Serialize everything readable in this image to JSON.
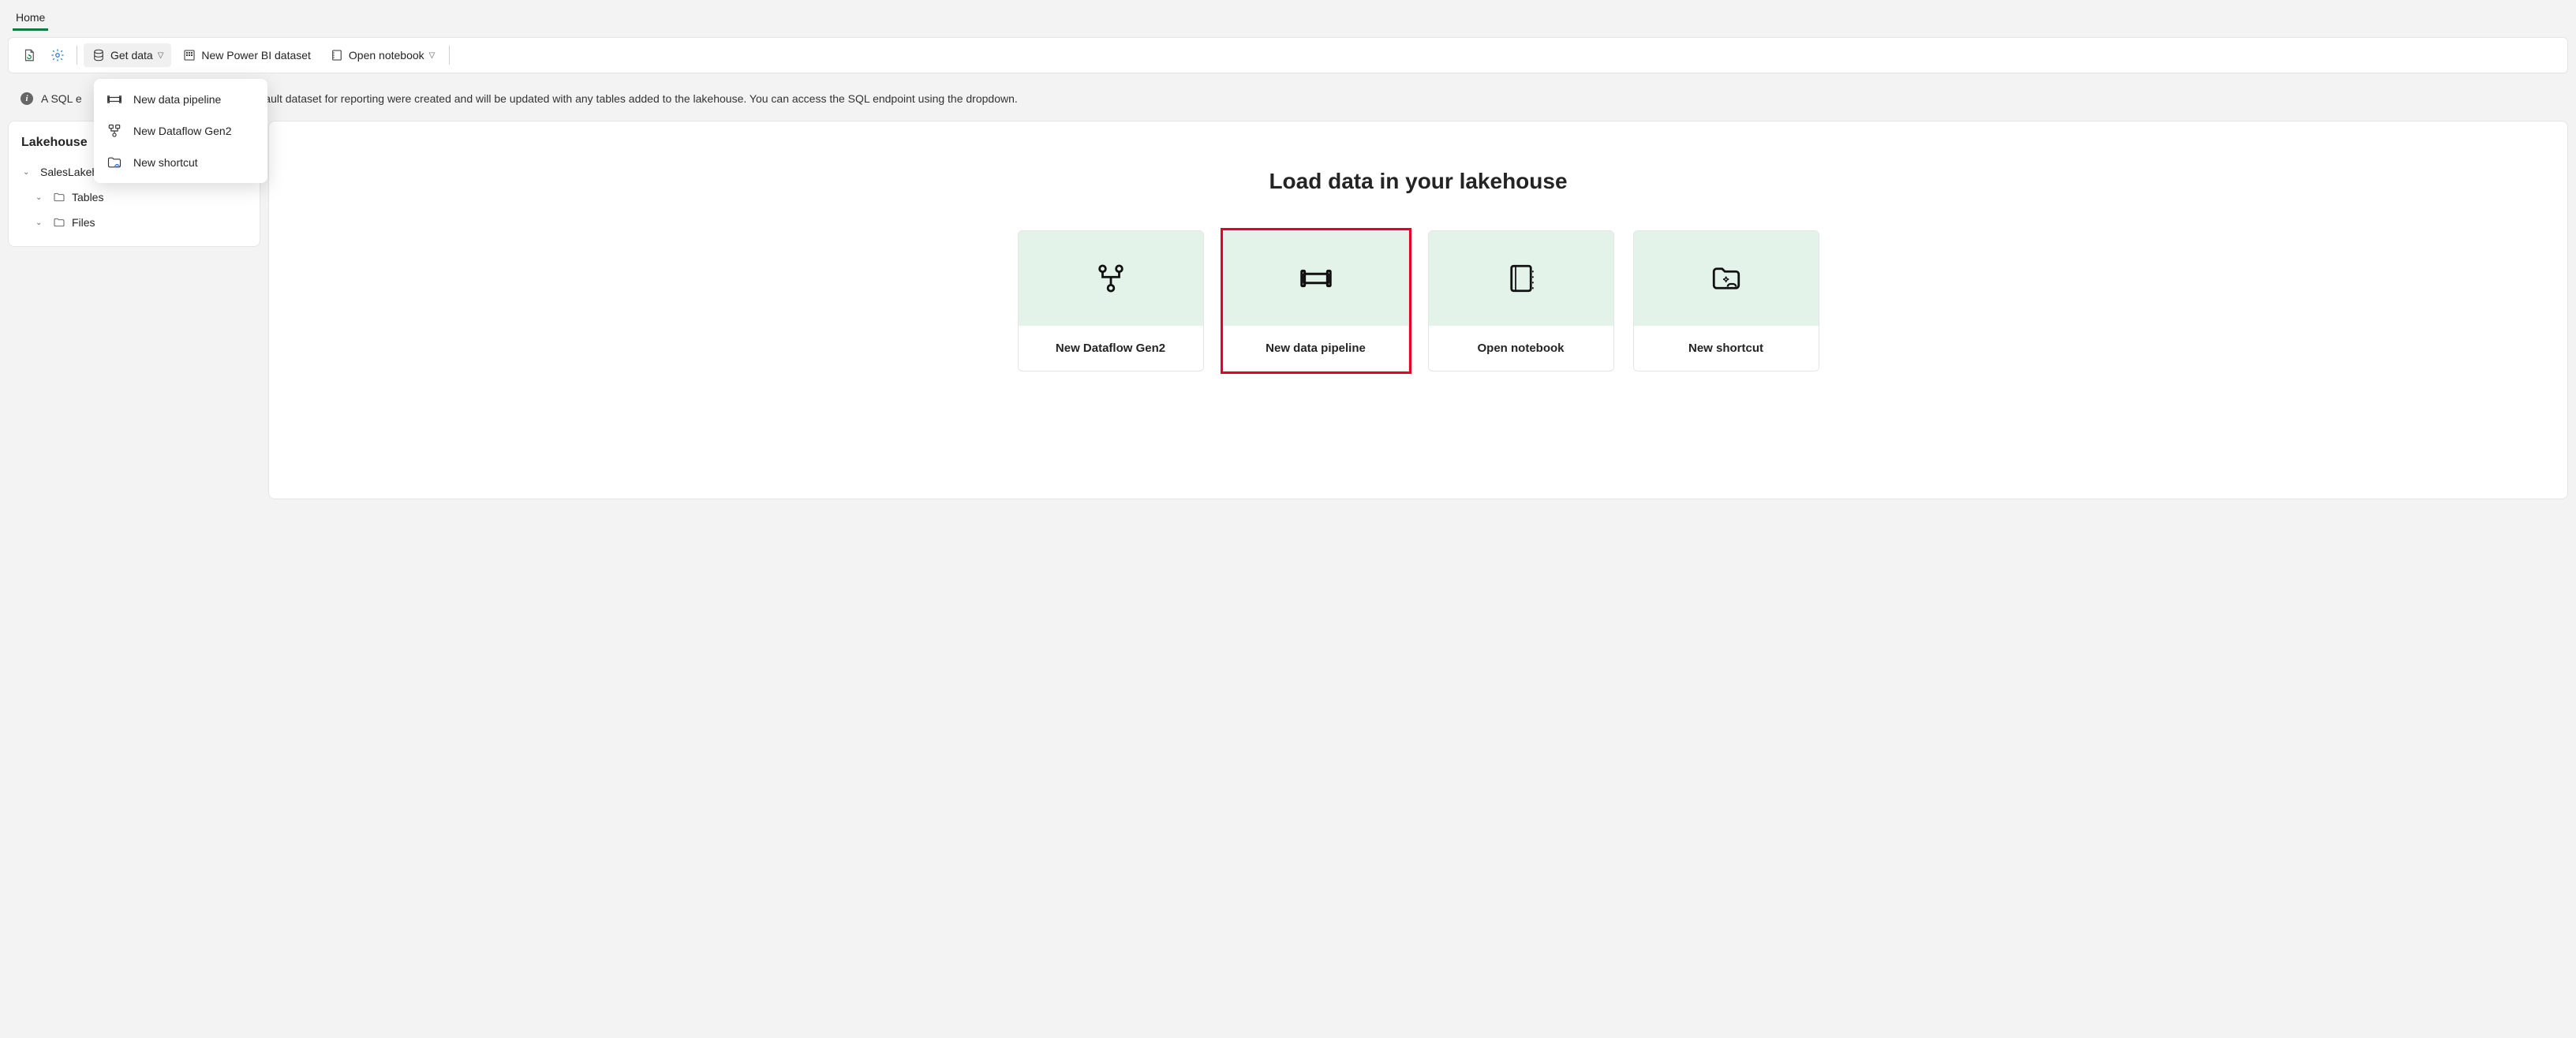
{
  "tabs": {
    "home": "Home"
  },
  "ribbon": {
    "get_data": "Get data",
    "new_dataset": "New Power BI dataset",
    "open_notebook": "Open notebook"
  },
  "dropdown": {
    "new_pipeline": "New data pipeline",
    "new_dataflow": "New Dataflow Gen2",
    "new_shortcut": "New shortcut"
  },
  "info_bar": {
    "prefix": "A SQL e",
    "rest": "efault dataset for reporting were created and will be updated with any tables added to the lakehouse. You can access the SQL endpoint using the dropdown."
  },
  "explorer": {
    "title": "Lakehouse",
    "root": "SalesLakehouse",
    "tables": "Tables",
    "files": "Files"
  },
  "main": {
    "title": "Load data in your lakehouse",
    "cards": {
      "dataflow": "New Dataflow Gen2",
      "pipeline": "New data pipeline",
      "notebook": "Open notebook",
      "shortcut": "New shortcut"
    }
  }
}
